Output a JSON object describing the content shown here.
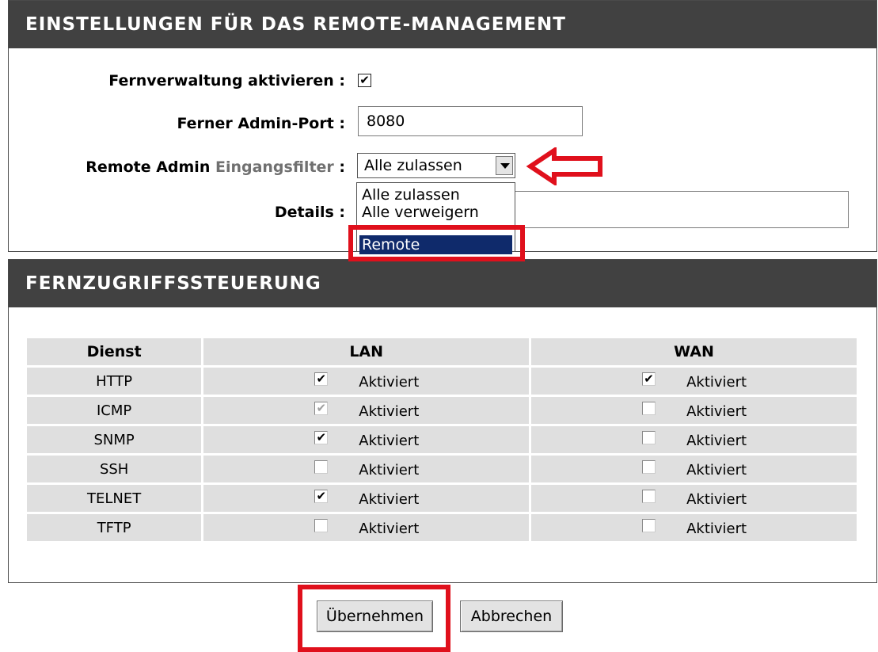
{
  "remote_management": {
    "header": "EINSTELLUNGEN FÜR DAS REMOTE-MANAGEMENT",
    "enable_label": "Fernverwaltung aktivieren :",
    "enable_checked": true,
    "port_label": "Ferner Admin-Port :",
    "port_value": "8080",
    "filter_label_bold": "Remote Admin",
    "filter_label_grey": "Eingangsfilter",
    "filter_label_colon": " :",
    "filter_selected": "Alle zulassen",
    "filter_options": [
      "Alle zulassen",
      "Alle verweigern",
      "Remote"
    ],
    "details_label": "Details :",
    "details_value": ""
  },
  "access_control": {
    "header": "FERNZUGRIFFSSTEUERUNG",
    "columns": [
      "Dienst",
      "LAN",
      "WAN"
    ],
    "enabled_text": "Aktiviert",
    "rows": [
      {
        "service": "HTTP",
        "lan": true,
        "wan": true
      },
      {
        "service": "ICMP",
        "lan": true,
        "wan": false,
        "lan_disabled": true
      },
      {
        "service": "SNMP",
        "lan": true,
        "wan": false
      },
      {
        "service": "SSH",
        "lan": false,
        "wan": false
      },
      {
        "service": "TELNET",
        "lan": true,
        "wan": false
      },
      {
        "service": "TFTP",
        "lan": false,
        "wan": false
      }
    ]
  },
  "buttons": {
    "apply": "Übernehmen",
    "cancel": "Abbrechen"
  },
  "annotation_color": "#e0101c"
}
